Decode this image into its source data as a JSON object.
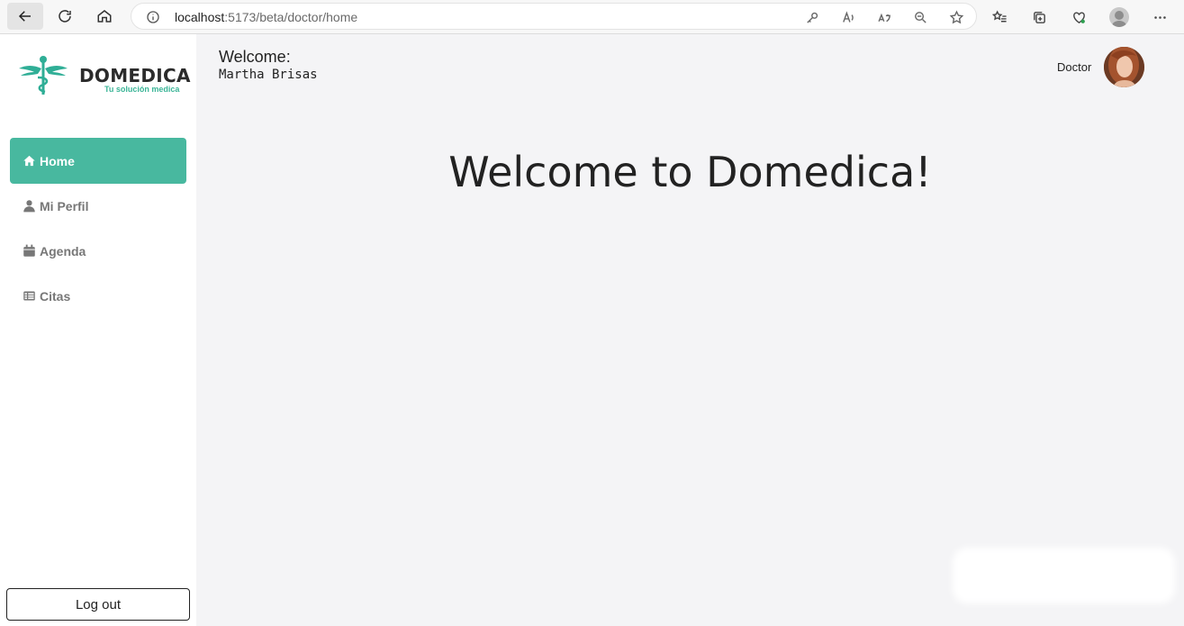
{
  "browser": {
    "url_host": "localhost",
    "url_rest": ":5173/beta/doctor/home"
  },
  "brand": {
    "name": "DOMEDICA",
    "tagline": "Tu solución medica",
    "accent": "#48b89f"
  },
  "sidebar": {
    "items": [
      {
        "label": "Home",
        "icon": "home-icon",
        "active": true
      },
      {
        "label": "Mi Perfil",
        "icon": "user-icon",
        "active": false
      },
      {
        "label": "Agenda",
        "icon": "calendar-icon",
        "active": false
      },
      {
        "label": "Citas",
        "icon": "table-list-icon",
        "active": false
      }
    ],
    "logout_label": "Log out"
  },
  "header": {
    "welcome_label": "Welcome:",
    "user_name": "Martha Brisas",
    "role": "Doctor"
  },
  "main": {
    "hero_title": "Welcome to Domedica!"
  }
}
